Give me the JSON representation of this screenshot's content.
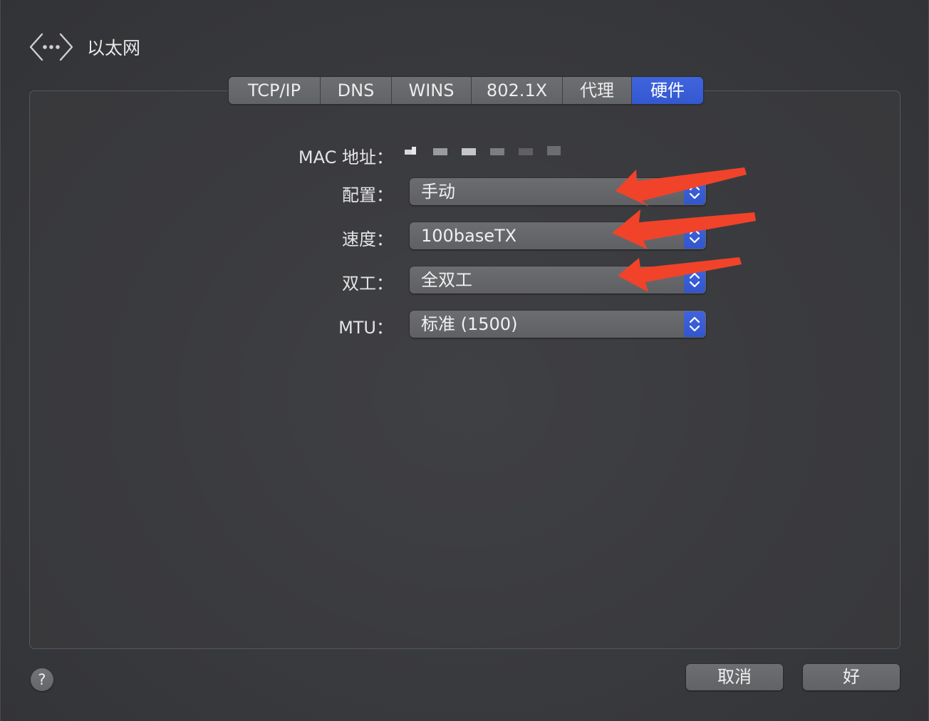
{
  "header": {
    "title": "以太网",
    "icon": "network-service-icon"
  },
  "tabs": [
    {
      "label": "TCP/IP",
      "selected": false
    },
    {
      "label": "DNS",
      "selected": false
    },
    {
      "label": "WINS",
      "selected": false
    },
    {
      "label": "802.1X",
      "selected": false
    },
    {
      "label": "代理",
      "selected": false
    },
    {
      "label": "硬件",
      "selected": true
    }
  ],
  "form": {
    "mac_label": "MAC 地址：",
    "config": {
      "label": "配置：",
      "value": "手动"
    },
    "speed": {
      "label": "速度：",
      "value": "100baseTX"
    },
    "duplex": {
      "label": "双工：",
      "value": "全双工"
    },
    "mtu": {
      "label": "MTU：",
      "value": "标准 (1500)"
    }
  },
  "footer": {
    "help_label": "?",
    "cancel_label": "取消",
    "ok_label": "好"
  },
  "colors": {
    "accent": "#3f64dd",
    "annotation_arrow": "#f0432a",
    "background": "#3a3b3e"
  }
}
